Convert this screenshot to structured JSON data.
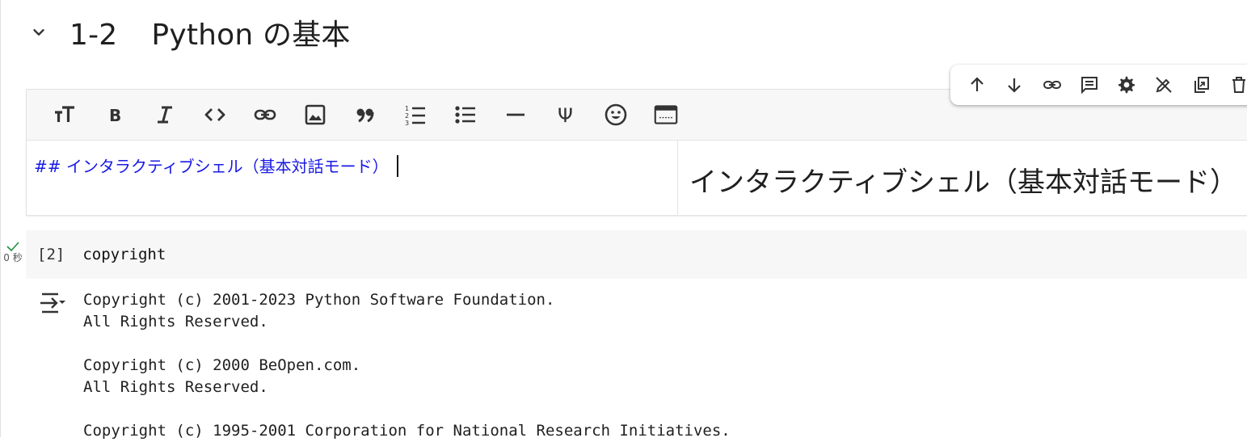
{
  "section": {
    "number": "1-2",
    "title": "Python の基本"
  },
  "markdown_cell": {
    "source": "## インタラクティブシェル（基本対話モード）",
    "preview": "インタラクティブシェル（基本対話モード）"
  },
  "code_cell": {
    "exec_count": "[2]",
    "source": "copyright",
    "exec_time": "0 秒"
  },
  "output": {
    "lines": [
      "Copyright (c) 2001-2023 Python Software Foundation.",
      "All Rights Reserved.",
      "",
      "Copyright (c) 2000 BeOpen.com.",
      "All Rights Reserved.",
      "",
      "Copyright (c) 1995-2001 Corporation for National Research Initiatives."
    ]
  },
  "icons": {
    "cell_toolbar": [
      "arrow-up-icon",
      "arrow-down-icon",
      "link-icon",
      "comment-icon",
      "gear-icon",
      "edit-off-icon",
      "mirror-cell-icon",
      "delete-icon"
    ],
    "format_toolbar": [
      "text-size-icon",
      "bold-icon",
      "italic-icon",
      "code-icon",
      "link-icon",
      "image-icon",
      "quote-icon",
      "numbered-list-icon",
      "bulleted-list-icon",
      "horizontal-rule-icon",
      "latex-psi-icon",
      "emoji-icon",
      "table-icon"
    ]
  },
  "colors": {
    "markdown_source": "#1a1ae6",
    "exec_check": "#1e8e3e",
    "toolbar_bg": "#f7f7f7"
  }
}
